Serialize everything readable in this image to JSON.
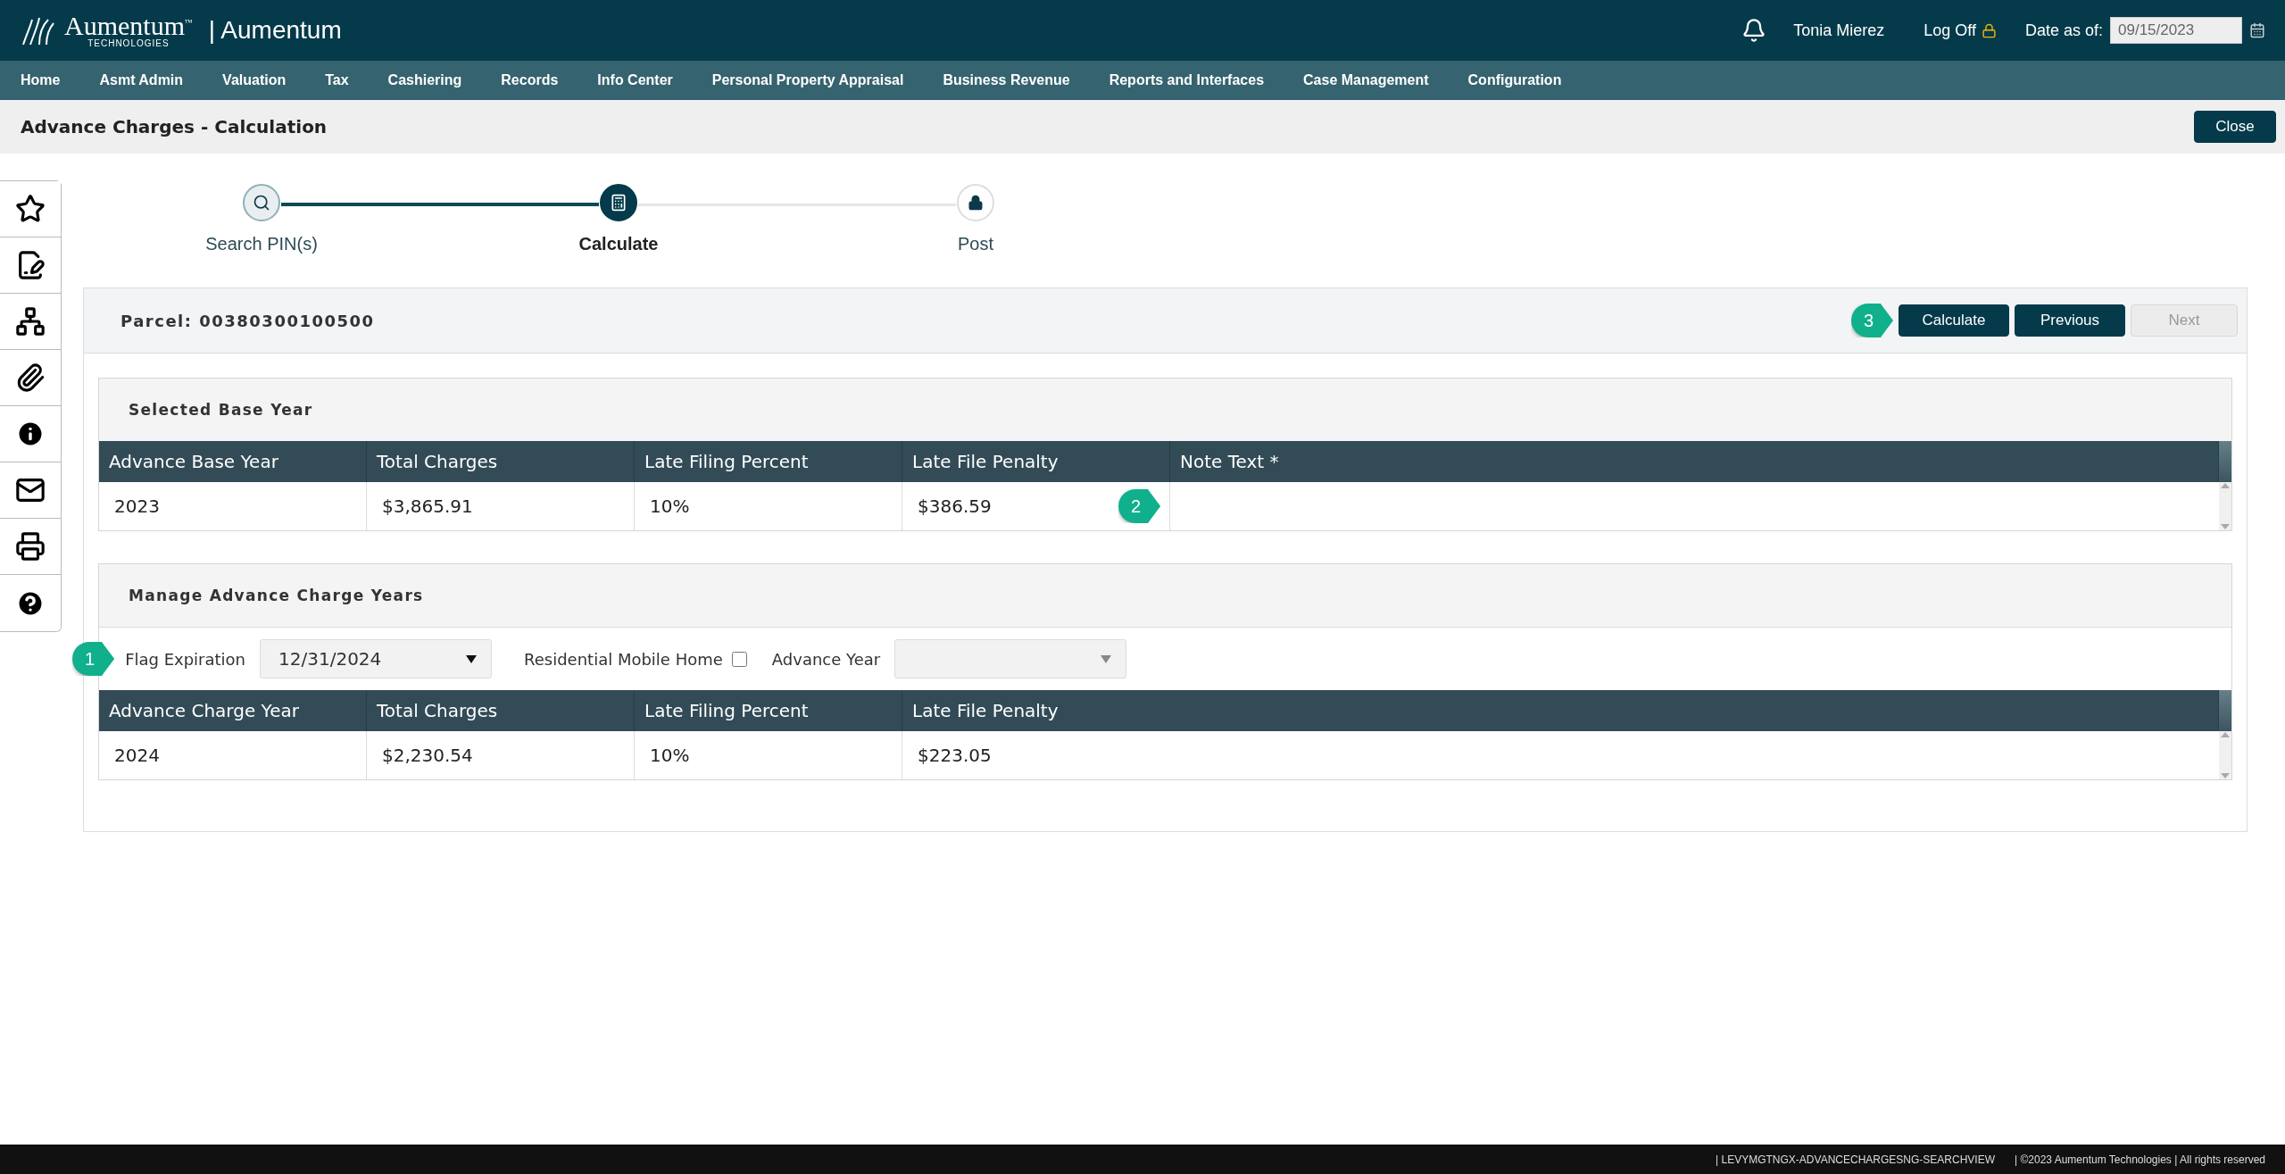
{
  "header": {
    "logo_word": "Aumentum",
    "logo_tm": "™",
    "logo_sub": "TECHNOLOGIES",
    "app_name": "| Aumentum",
    "user": "Tonia Mierez",
    "log_off": "Log Off",
    "date_label": "Date as of:",
    "date_value": "09/15/2023"
  },
  "nav": [
    "Home",
    "Asmt Admin",
    "Valuation",
    "Tax",
    "Cashiering",
    "Records",
    "Info Center",
    "Personal Property Appraisal",
    "Business Revenue",
    "Reports and Interfaces",
    "Case Management",
    "Configuration"
  ],
  "page_title": "Advance Charges - Calculation",
  "close_button": "Close",
  "sidebar": [
    {
      "kind": "star"
    },
    {
      "kind": "edit"
    },
    {
      "kind": "tree"
    },
    {
      "kind": "clip"
    },
    {
      "kind": "info"
    },
    {
      "kind": "mail"
    },
    {
      "kind": "print"
    },
    {
      "kind": "help"
    }
  ],
  "stepper": [
    {
      "label": "Search PIN(s)",
      "completed": true,
      "selected": false
    },
    {
      "label": "Calculate",
      "completed": false,
      "selected": true
    },
    {
      "label": "Post",
      "completed": false,
      "selected": false
    }
  ],
  "parcel": {
    "title": "Parcel: 00380300100500",
    "callout": "3",
    "buttons": [
      {
        "label": "Calculate",
        "disabled": false
      },
      {
        "label": "Previous",
        "disabled": false
      },
      {
        "label": "Next",
        "disabled": true
      }
    ]
  },
  "base_year": {
    "title": "Selected Base Year",
    "columns": [
      "Advance Base Year",
      "Total Charges",
      "Late Filing Percent",
      "Late File Penalty",
      "Note Text *"
    ],
    "rows": [
      [
        "2023",
        "$3,865.91",
        "10%",
        "$386.59"
      ]
    ],
    "note_callout": "2"
  },
  "manage": {
    "title": "Manage Advance Charge Years",
    "callout": "1",
    "flag_label": "Flag Expiration",
    "flag_value": "12/31/2024",
    "mobile_label": "Residential Mobile Home",
    "mobile_checked": false,
    "year_label": "Advance Year",
    "columns": [
      "Advance Charge Year",
      "Total Charges",
      "Late Filing Percent",
      "Late File Penalty"
    ],
    "rows": [
      [
        "2024",
        "$2,230.54",
        "10%",
        "$223.05"
      ]
    ]
  },
  "footer": {
    "view": "|   LEVYMGTNGX-ADVANCECHARGESNG-SEARCHVIEW",
    "copyright": "|   ©2023 Aumentum Technologies | All rights reserved"
  }
}
